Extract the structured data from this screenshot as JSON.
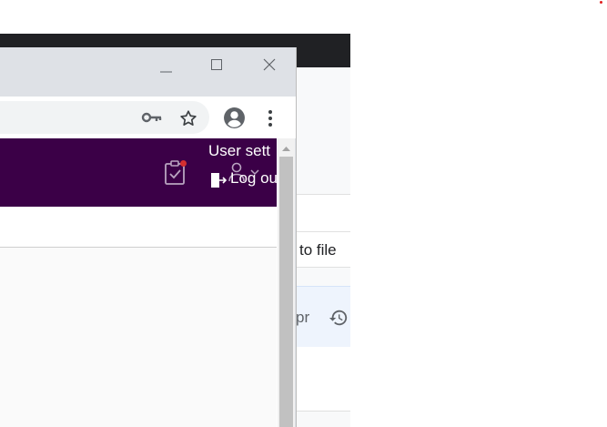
{
  "background_app": {
    "export_label": "to file",
    "date_fragment": "pr",
    "history_icon": "history-icon"
  },
  "browser": {
    "window_controls": [
      "minimize-icon",
      "maximize-icon",
      "close-icon"
    ],
    "toolbar_icons": [
      "key-icon",
      "star-icon",
      "profile-icon",
      "more-vert-icon"
    ]
  },
  "app_header": {
    "color": "#3b0047",
    "notification_color": "#d32f2f",
    "user_menu": {
      "settings_label": "User sett",
      "logout_label": "Log ou"
    }
  }
}
